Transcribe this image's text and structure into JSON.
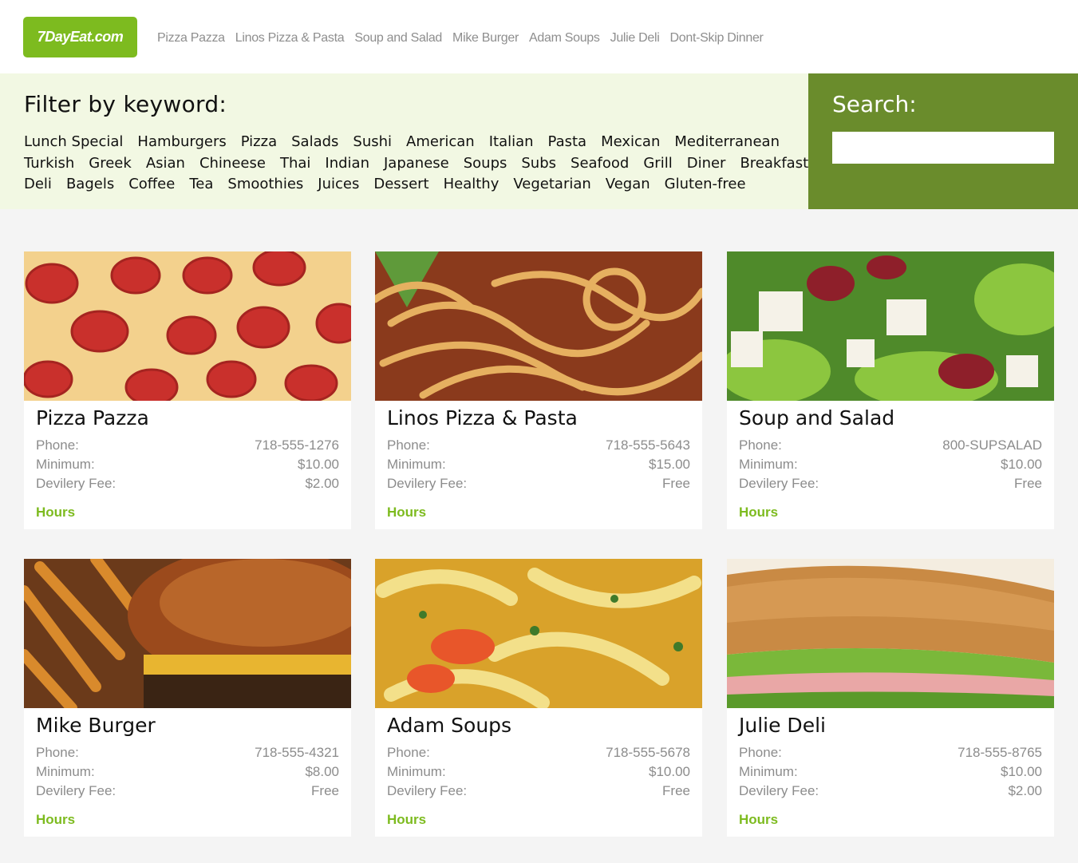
{
  "header": {
    "logo": "7DayEat.com",
    "nav": [
      "Pizza Pazza",
      "Linos Pizza & Pasta",
      "Soup and Salad",
      "Mike Burger",
      "Adam Soups",
      "Julie Deli",
      "Dont-Skip Dinner"
    ]
  },
  "filter": {
    "title": "Filter by keyword:",
    "rows": [
      [
        "Lunch Special",
        "Hamburgers",
        "Pizza",
        "Salads",
        "Sushi",
        "American",
        "Italian",
        "Pasta",
        "Mexican",
        "Mediterranean"
      ],
      [
        "Turkish",
        "Greek",
        "Asian",
        "Chineese",
        "Thai",
        "Indian",
        "Japanese",
        "Soups",
        "Subs",
        "Seafood",
        "Grill",
        "Diner",
        "Breakfast"
      ],
      [
        "Deli",
        "Bagels",
        "Coffee",
        "Tea",
        "Smoothies",
        "Juices",
        "Dessert",
        "Healthy",
        "Vegetarian",
        "Vegan",
        "Gluten-free"
      ]
    ]
  },
  "search": {
    "title": "Search:",
    "value": ""
  },
  "labels": {
    "phone": "Phone:",
    "minimum": "Minimum:",
    "fee": "Devilery Fee:",
    "hours": "Hours"
  },
  "restaurants": [
    {
      "name": "Pizza Pazza",
      "phone": "718-555-1276",
      "minimum": "$10.00",
      "fee": "$2.00",
      "image": "pizza-photo"
    },
    {
      "name": "Linos Pizza & Pasta",
      "phone": "718-555-5643",
      "minimum": "$15.00",
      "fee": "Free",
      "image": "pasta-photo"
    },
    {
      "name": "Soup and Salad",
      "phone": "800-SUPSALAD",
      "minimum": "$10.00",
      "fee": "Free",
      "image": "salad-photo"
    },
    {
      "name": "Mike Burger",
      "phone": "718-555-4321",
      "minimum": "$8.00",
      "fee": "Free",
      "image": "burger-photo"
    },
    {
      "name": "Adam Soups",
      "phone": "718-555-5678",
      "minimum": "$10.00",
      "fee": "Free",
      "image": "soup-photo"
    },
    {
      "name": "Julie Deli",
      "phone": "718-555-8765",
      "minimum": "$10.00",
      "fee": "$2.00",
      "image": "sandwich-photo"
    }
  ],
  "colors": {
    "brand": "#7dbb1f",
    "filter_bg": "#f2f8e3",
    "search_bg": "#6a8c2c"
  }
}
